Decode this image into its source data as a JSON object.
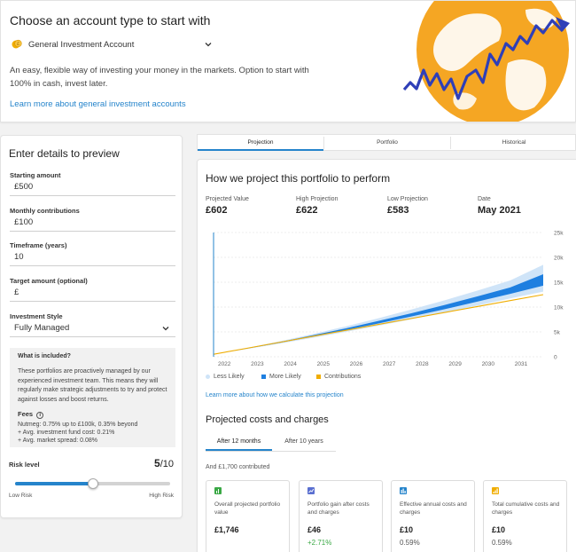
{
  "header": {
    "title": "Choose an account type to start with",
    "account_selected": "General Investment Account",
    "description": "An easy, flexible way of investing your money in the markets. Option to start with 100% in cash, invest later.",
    "learn_more": "Learn more about general investment accounts"
  },
  "form": {
    "title": "Enter details to preview",
    "starting_amount_label": "Starting amount",
    "starting_amount_value": "£500",
    "monthly_label": "Monthly contributions",
    "monthly_value": "£100",
    "timeframe_label": "Timeframe (years)",
    "timeframe_value": "10",
    "target_label": "Target amount (optional)",
    "target_value": "£",
    "style_label": "Investment Style",
    "style_value": "Fully Managed",
    "info_title": "What is included?",
    "info_body": "These portfolios are proactively managed by our experienced investment team. This means they will regularly make strategic adjustments to try and protect against losses and boost returns.",
    "fees_title": "Fees",
    "fees_icon": "i",
    "fees": [
      "Nutmeg: 0.75% up to £100k, 0.35% beyond",
      "+ Avg. investment fund cost: 0.21%",
      "+ Avg. market spread: 0.08%"
    ],
    "risk_label": "Risk level",
    "risk_value": "5",
    "risk_max": "/10",
    "risk_level": 5,
    "risk_scale_max": 10,
    "risk_low": "Low Risk",
    "risk_high": "High Risk"
  },
  "tabs": [
    "Projection",
    "Portfolio",
    "Historical"
  ],
  "projection": {
    "title": "How we project this portfolio to perform",
    "stats": [
      {
        "label": "Projected Value",
        "value": "£602"
      },
      {
        "label": "High Projection",
        "value": "£622"
      },
      {
        "label": "Low Projection",
        "value": "£583"
      },
      {
        "label": "Date",
        "value": "May 2021"
      }
    ],
    "legend": {
      "less_likely": "Less Likely",
      "more_likely": "More Likely",
      "contributions": "Contributions"
    },
    "learn_more": "Learn more about how we calculate this projection"
  },
  "colors": {
    "accent": "#2584cb",
    "less_likely": "#cfe4f8",
    "more_likely": "#1e7fe0",
    "contributions": "#f0ad00",
    "positive": "#3aa845",
    "globe": "#f5a623"
  },
  "chart_data": {
    "type": "area",
    "x": [
      "2021",
      "2022",
      "2023",
      "2024",
      "2025",
      "2026",
      "2027",
      "2028",
      "2029",
      "2030",
      "2031"
    ],
    "x_tick_labels": [
      "2022",
      "2023",
      "2024",
      "2025",
      "2026",
      "2027",
      "2028",
      "2029",
      "2030",
      "2031"
    ],
    "y_tick_labels": [
      "0",
      "5k",
      "10k",
      "15k",
      "20k",
      "25k"
    ],
    "ylim": [
      0,
      25000
    ],
    "series": [
      {
        "name": "Less Likely",
        "low": [
          500,
          1550,
          2650,
          3800,
          5000,
          6250,
          7550,
          8900,
          10300,
          11750,
          13100
        ],
        "high": [
          500,
          1750,
          3100,
          4550,
          6100,
          7750,
          9500,
          11350,
          13300,
          15350,
          18500
        ]
      },
      {
        "name": "More Likely",
        "low": [
          500,
          1630,
          2800,
          4050,
          5350,
          6700,
          8100,
          9550,
          11100,
          12650,
          14300
        ],
        "high": [
          500,
          1700,
          2950,
          4300,
          5700,
          7200,
          8750,
          10400,
          12150,
          13950,
          16600
        ]
      },
      {
        "name": "Contributions",
        "values": [
          500,
          1700,
          2900,
          4100,
          5300,
          6500,
          7700,
          8900,
          10100,
          11300,
          12500
        ]
      }
    ]
  },
  "costs": {
    "title": "Projected costs and charges",
    "tabs": [
      "After 12 months",
      "After 10 years"
    ],
    "contributed": "And £1,700 contributed",
    "cards": [
      {
        "icon": "bar-chart-icon",
        "title": "Overall projected portfolio value",
        "value": "£1,746",
        "sub": ""
      },
      {
        "icon": "line-chart-icon",
        "title": "Portfolio gain after costs and charges",
        "value": "£46",
        "sub": "+2.71%"
      },
      {
        "icon": "column-chart-icon",
        "title": "Effective annual costs and charges",
        "value": "£10",
        "sub": "0.59%"
      },
      {
        "icon": "cumulative-chart-icon",
        "title": "Total cumulative costs and charges",
        "value": "£10",
        "sub": "0.59%"
      }
    ]
  }
}
